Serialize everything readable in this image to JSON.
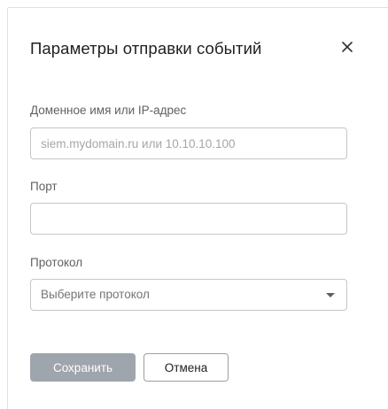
{
  "dialog": {
    "title": "Параметры отправки событий",
    "close_icon": "close-icon"
  },
  "fields": {
    "host": {
      "label": "Доменное имя или IP-адрес",
      "value": "",
      "placeholder": "siem.mydomain.ru или 10.10.10.100"
    },
    "port": {
      "label": "Порт",
      "value": "",
      "placeholder": ""
    },
    "protocol": {
      "label": "Протокол",
      "selected": "Выберите протокол",
      "icon": "chevron-down-icon"
    }
  },
  "actions": {
    "save_label": "Сохранить",
    "cancel_label": "Отмена",
    "save_enabled": false
  },
  "colors": {
    "save_button_bg": "#9ea5ad",
    "border": "#c6c6c6",
    "text": "#212121"
  }
}
